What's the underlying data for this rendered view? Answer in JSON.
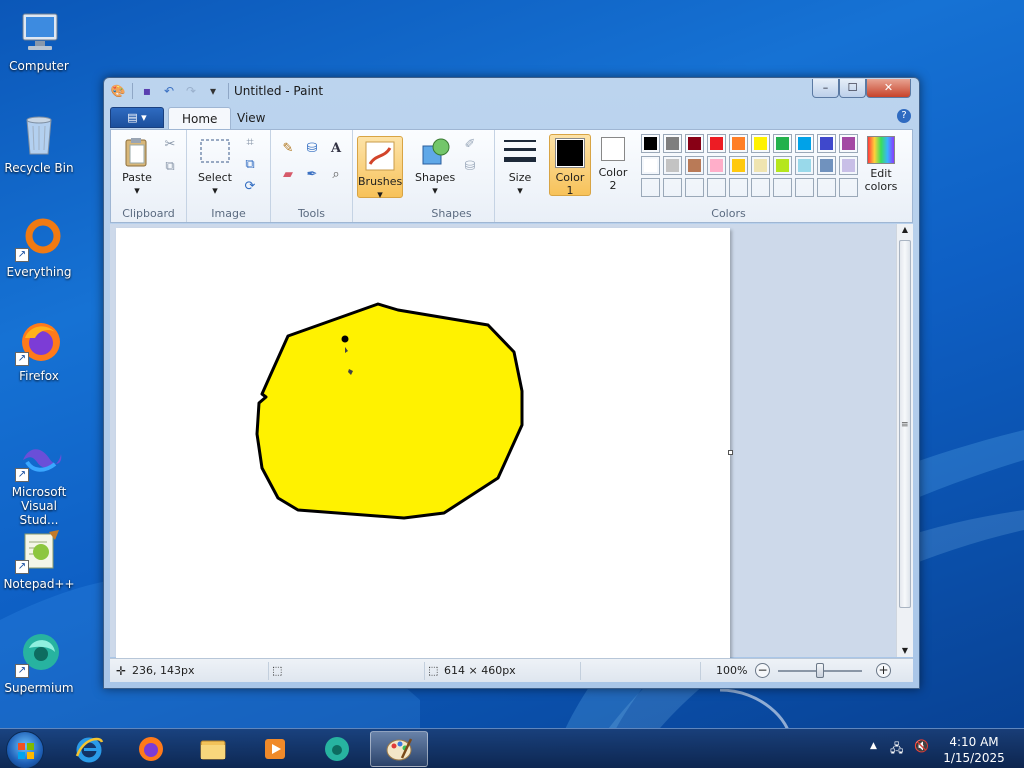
{
  "desktop": {
    "icons": [
      {
        "label": "Computer",
        "icon": "computer-icon"
      },
      {
        "label": "Recycle Bin",
        "icon": "recycle-bin-icon"
      },
      {
        "label": "Everything",
        "icon": "everything-icon"
      },
      {
        "label": "Firefox",
        "icon": "firefox-icon"
      },
      {
        "label": "Microsoft Visual Stud...",
        "icon": "visual-studio-icon"
      },
      {
        "label": "Notepad++",
        "icon": "notepad-plus-plus-icon"
      },
      {
        "label": "Supermium",
        "icon": "supermium-icon"
      }
    ]
  },
  "window": {
    "title": "Untitled - Paint",
    "controls": {
      "minimize": "–",
      "maximize": "☐",
      "close": "✕"
    }
  },
  "ribbon": {
    "menu_glyph": "▤ ▾",
    "tabs": [
      "Home",
      "View"
    ],
    "active_tab": "Home",
    "help": "?",
    "groups": {
      "clipboard": {
        "label": "Clipboard",
        "paste": "Paste"
      },
      "image": {
        "label": "Image",
        "select": "Select"
      },
      "tools": {
        "label": "Tools"
      },
      "brushes": {
        "label": "Brushes"
      },
      "shapes": {
        "label": "Shapes",
        "button": "Shapes"
      },
      "size": {
        "label": "Size"
      },
      "colors": {
        "label": "Colors",
        "color1": {
          "line1": "Color",
          "line2": "1",
          "value": "#000000"
        },
        "color2": {
          "line1": "Color",
          "line2": "2",
          "value": "#ffffff"
        },
        "edit_colors": {
          "line1": "Edit",
          "line2": "colors"
        },
        "palette_row1": [
          "#000000",
          "#7f7f7f",
          "#880015",
          "#ed1c24",
          "#ff7f27",
          "#fff200",
          "#22b14c",
          "#00a2e8",
          "#3f48cc",
          "#a349a4"
        ],
        "palette_row2": [
          "#ffffff",
          "#c3c3c3",
          "#b97a57",
          "#ffaec9",
          "#ffc90e",
          "#efe4b0",
          "#b5e61d",
          "#99d9ea",
          "#7092be",
          "#c8bfe7"
        ]
      }
    }
  },
  "canvas": {
    "shape_fill": "#fff200",
    "shape_stroke": "#000000",
    "background": "#ffffff"
  },
  "status": {
    "cursor_pos": "236, 143px",
    "image_size": "614 × 460px",
    "zoom": "100%"
  },
  "taskbar": {
    "time": "4:10 AM",
    "date": "1/15/2025"
  }
}
